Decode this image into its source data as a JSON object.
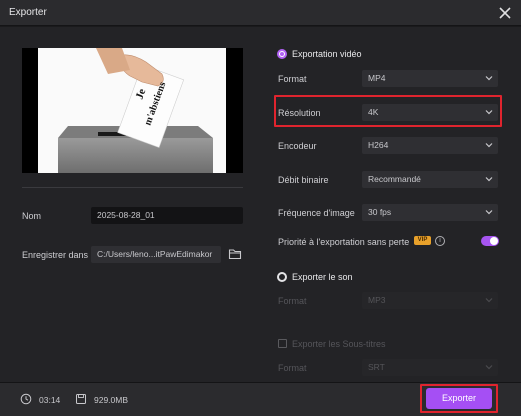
{
  "window": {
    "title": "Exporter"
  },
  "left": {
    "name_label": "Nom",
    "name_value": "2025-08-28_01",
    "save_label": "Enregistrer dans",
    "save_value": "C:/Users/leno...itPawEdimakor"
  },
  "video": {
    "section_label": "Exportation vidéo",
    "format_label": "Format",
    "format_value": "MP4",
    "resolution_label": "Résolution",
    "resolution_value": "4K",
    "encoder_label": "Encodeur",
    "encoder_value": "H264",
    "bitrate_label": "Débit binaire",
    "bitrate_value": "Recommandé",
    "framerate_label": "Fréquence d'image",
    "framerate_value": "30  fps",
    "priority_label": "Priorité à l'exportation sans perte",
    "vip_badge": "VIP",
    "info_glyph": "i",
    "priority_enabled": true
  },
  "audio": {
    "section_label": "Exporter le son",
    "format_label": "Format",
    "format_value": "MP3"
  },
  "subtitles": {
    "section_label": "Exporter les Sous-titres",
    "format_label": "Format",
    "format_value": "SRT"
  },
  "preview": {
    "card_line1": "Je",
    "card_line2": "m'abstiens"
  },
  "footer": {
    "duration": "03:14",
    "size": "929.0MB",
    "export_label": "Exporter"
  },
  "colors": {
    "accent": "#a54ff4",
    "highlight": "#e0242e",
    "vip": "#e8a12b"
  }
}
